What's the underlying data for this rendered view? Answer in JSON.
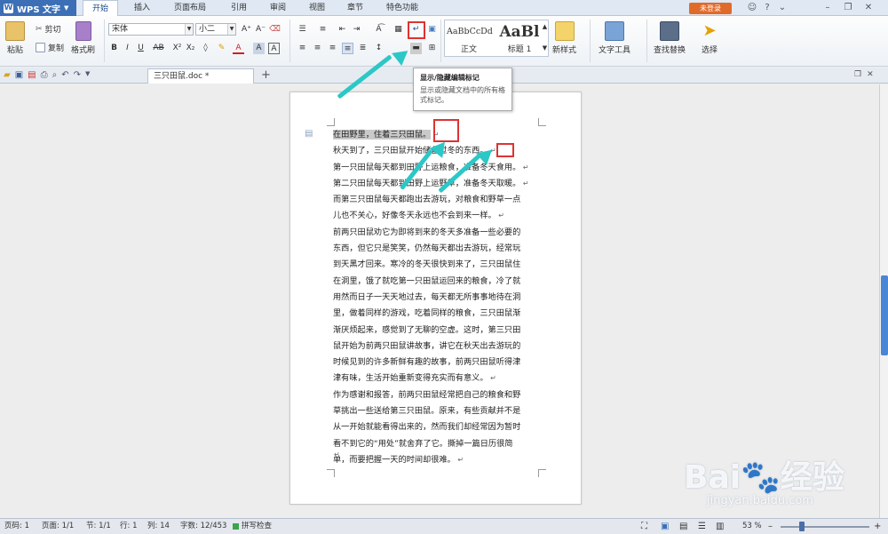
{
  "app": {
    "name": "WPS 文字",
    "login": "未登录"
  },
  "menu_tabs": [
    "开始",
    "插入",
    "页面布局",
    "引用",
    "审阅",
    "视图",
    "章节",
    "特色功能"
  ],
  "ribbon": {
    "paste": "粘贴",
    "cut": "剪切",
    "copy": "复制",
    "format_painter": "格式刷",
    "font_name": "宋体",
    "font_size": "小二",
    "style_normal_preview": "AaBbCcDd",
    "style_normal": "正文",
    "style_h1_preview": "AaBl",
    "style_h1": "标题 1",
    "new_style": "新样式",
    "text_tools": "文字工具",
    "find_replace": "查找替换",
    "select": "选择"
  },
  "doc_tab": "三只田鼠.doc *",
  "tooltip": {
    "title": "显示/隐藏编辑标记",
    "desc": "显示或隐藏文档中的所有格式标记。"
  },
  "document": {
    "lines": [
      "在田野里，住着三只田鼠。",
      "秋天到了，三只田鼠开始储备过冬的东西。",
      "第一只田鼠每天都到田野上运粮食，准备冬天食用。",
      "第二只田鼠每天都到田野上运野草，准备冬天取暖。",
      "而第三只田鼠每天都跑出去游玩，对粮食和野草一点",
      "儿也不关心，好像冬天永远也不会到来一样。",
      "前两只田鼠劝它为即将到来的冬天多准备一些必要的",
      "东西，但它只是笑笑，仍然每天都出去游玩，经常玩",
      "到天黑才回来。寒冷的冬天很快到来了，三只田鼠住",
      "在洞里，饿了就吃第一只田鼠运回来的粮食，冷了就",
      "用然而日子一天天地过去，每天都无所事事地待在洞",
      "里，做着同样的游戏，吃着同样的粮食，三只田鼠渐",
      "渐厌烦起来，感觉到了无聊的空虚。这时，第三只田",
      "鼠开始为前两只田鼠讲故事，讲它在秋天出去游玩的",
      "时候见到的许多新鲜有趣的故事，前两只田鼠听得津",
      "津有味，生活开始重新变得充实而有意义。",
      "作为感谢和报答，前两只田鼠经常把自己的粮食和野",
      "草挑出一些送给第三只田鼠。原来，有些贡献并不是",
      "从一开始就能看得出来的，然而我们却经常因为暂时",
      "看不到它的“用处”就舍弃了它。撕掉一篇日历很简",
      "单，而要把握一天的时间却很难。"
    ],
    "para_ends": [
      0,
      1,
      2,
      3,
      5,
      15,
      20
    ]
  },
  "status": {
    "page_num": "页码: 1",
    "pages": "页面: 1/1",
    "section": "节: 1/1",
    "row": "行: 1",
    "col": "列: 14",
    "words": "字数: 12/453",
    "spellcheck": "拼写检查",
    "zoom": "53 %"
  },
  "watermark": {
    "brand": "Bai",
    "brand2": "经验",
    "url": "jingyan.baidu.com"
  },
  "colors": {
    "arrow": "#2cc7c7",
    "highlight_box": "#dd3333",
    "app_blue": "#3c6fb6"
  }
}
